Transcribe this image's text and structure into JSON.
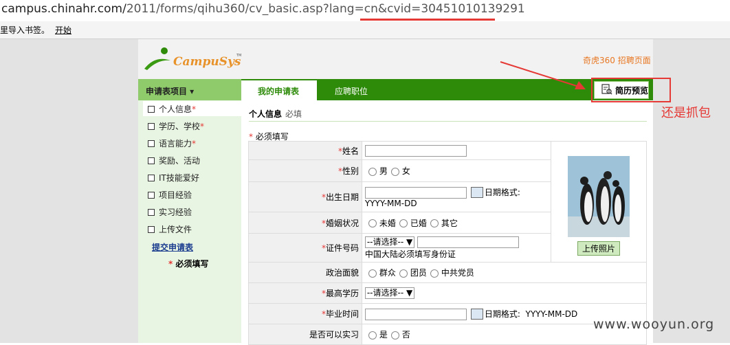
{
  "browser": {
    "url_prefix": "campus.chinahr.com/",
    "url_path": "2011/forms/qihu360/cv_basic.asp?lang=cn&cvid=30451010139291",
    "bookmark_text": "里导入书签。",
    "bookmark_link": "开始"
  },
  "header": {
    "logo_text": "CampuSys",
    "logo_tm": "TM",
    "recruit_link": "奇虎360 招聘页面"
  },
  "nav": {
    "sidebar_heading": "申请表项目 ▾",
    "tabs": [
      {
        "label": "我的申请表"
      },
      {
        "label": "应聘职位"
      }
    ],
    "preview_button": "简历预览"
  },
  "annotation": "还是抓包",
  "sidebar": {
    "items": [
      {
        "label": "个人信息",
        "required": "*"
      },
      {
        "label": "学历、学校",
        "required": "*"
      },
      {
        "label": "语言能力",
        "required": "*"
      },
      {
        "label": "奖励、活动",
        "required": ""
      },
      {
        "label": "IT技能爱好",
        "required": ""
      },
      {
        "label": "项目经验",
        "required": ""
      },
      {
        "label": "实习经验",
        "required": ""
      },
      {
        "label": "上传文件",
        "required": ""
      }
    ],
    "submit_link": "提交申请表",
    "required_note_star": "*",
    "required_note": "必须填写"
  },
  "main": {
    "section_title": "个人信息",
    "section_sub": "必填",
    "must_star": "*",
    "must_text": "必须填写",
    "fields": {
      "name": "姓名",
      "gender": "性别",
      "gender_options": [
        "男",
        "女"
      ],
      "birthdate": "出生日期",
      "date_format_label": "日期格式:",
      "date_format_hint": "YYYY-MM-DD",
      "marital": "婚姻状况",
      "marital_options": [
        "未婚",
        "已婚",
        "其它"
      ],
      "id_number": "证件号码",
      "id_select": "--请选择-- ▼",
      "id_hint": "中国大陆必须填写身份证",
      "political": "政治面貌",
      "political_options": [
        "群众",
        "团员",
        "中共党员"
      ],
      "education": "最高学历",
      "education_select": "--请选择-- ▼",
      "grad_time": "毕业时间",
      "grad_format_label": "日期格式:",
      "grad_format_hint": "YYYY-MM-DD",
      "internship": "是否可以实习",
      "internship_options": [
        "是",
        "否"
      ]
    },
    "upload_photo": "上传照片"
  },
  "watermark": "www.wooyun.org",
  "colors": {
    "nav_green": "#2e8b0a",
    "sidebar_bg": "#e9f5e3",
    "required_red": "#e53935",
    "recruit_orange": "#e87722"
  }
}
